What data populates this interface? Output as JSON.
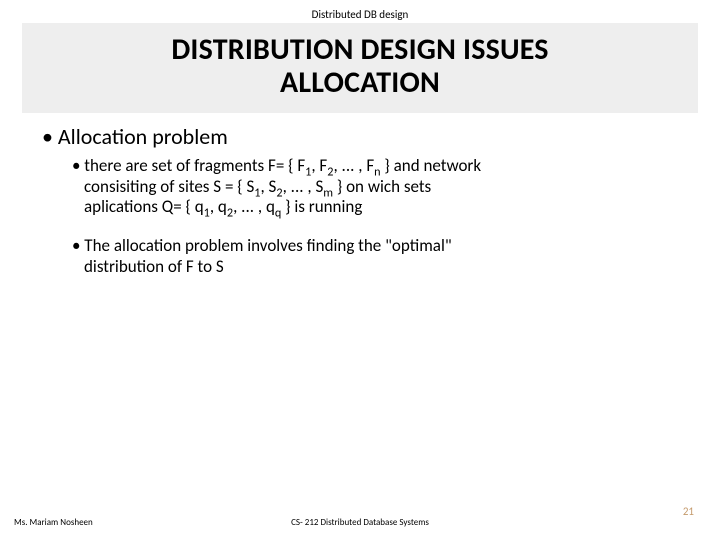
{
  "header": {
    "label": "Distributed DB design"
  },
  "title": {
    "line1": "DISTRIBUTION DESIGN ISSUES",
    "line2": "ALLOCATION"
  },
  "content": {
    "l1": "• Allocation problem",
    "b1_lead": "• there are set of fragments F= { F",
    "b1_sub1": "1",
    "b1_mid1": ", F",
    "b1_sub2": "2",
    "b1_mid2": ", ... , F",
    "b1_sub3": "n",
    "b1_after": " } and network",
    "b1_line2a": "consisiting of sites S = { S",
    "b1_s1": "1",
    "b1_line2b": ", S",
    "b1_s2": "2",
    "b1_line2c": ", ... , S",
    "b1_sm": "m",
    "b1_line2d": " } on wich sets",
    "b1_line3a": "aplications Q= { q",
    "b1_q1": "1",
    "b1_line3b": ", q",
    "b1_q2": "2",
    "b1_line3c": ", ... , q",
    "b1_qq": "q",
    "b1_line3d": " } is running",
    "b2_lead": "• The allocation problem involves finding the \"optimal\"",
    "b2_line2": "distribution of F to S"
  },
  "footer": {
    "left": "Ms. Mariam Nosheen",
    "center": "CS- 212 Distributed Database Systems",
    "right": "21"
  }
}
